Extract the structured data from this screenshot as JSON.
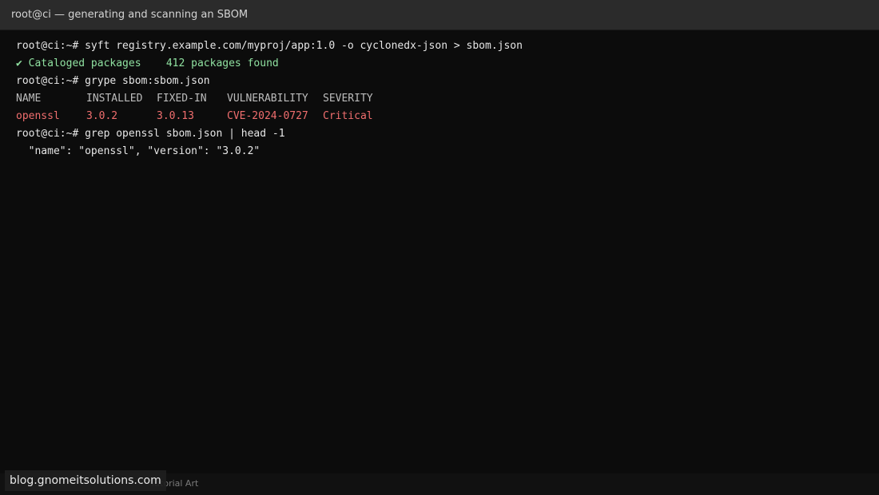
{
  "window": {
    "title": "root@ci — generating and scanning an SBOM"
  },
  "terminal": {
    "lines": [
      {
        "prompt": "root@ci:~# ",
        "command": "syft registry.example.com/myproj/app:1.0 -o cyclonedx-json > sbom.json"
      },
      {
        "text": "✔ Cataloged packages    412 packages found"
      },
      {
        "prompt": "root@ci:~# ",
        "command": "grype sbom:sbom.json"
      },
      {
        "table_header": [
          "NAME",
          "INSTALLED",
          "FIXED-IN",
          "VULNERABILITY",
          "SEVERITY"
        ]
      },
      {
        "table_row": [
          "openssl",
          "3.0.2",
          "3.0.13",
          "CVE-2024-0727",
          "Critical"
        ]
      },
      {
        "prompt": "root@ci:~# ",
        "command": "grep openssl sbom.json | head -1"
      },
      {
        "text": "  \"name\": \"openssl\", \"version\": \"3.0.2\""
      }
    ]
  },
  "footer": {
    "caption": "Tutorial Art",
    "watermark": "blog.gnomeitsolutions.com"
  },
  "colors": {
    "background": "#0c0c0c",
    "titlebar": "#2b2b2b",
    "success": "#8fe0a0",
    "critical": "#f06e6e",
    "text": "#e6e6e6"
  }
}
